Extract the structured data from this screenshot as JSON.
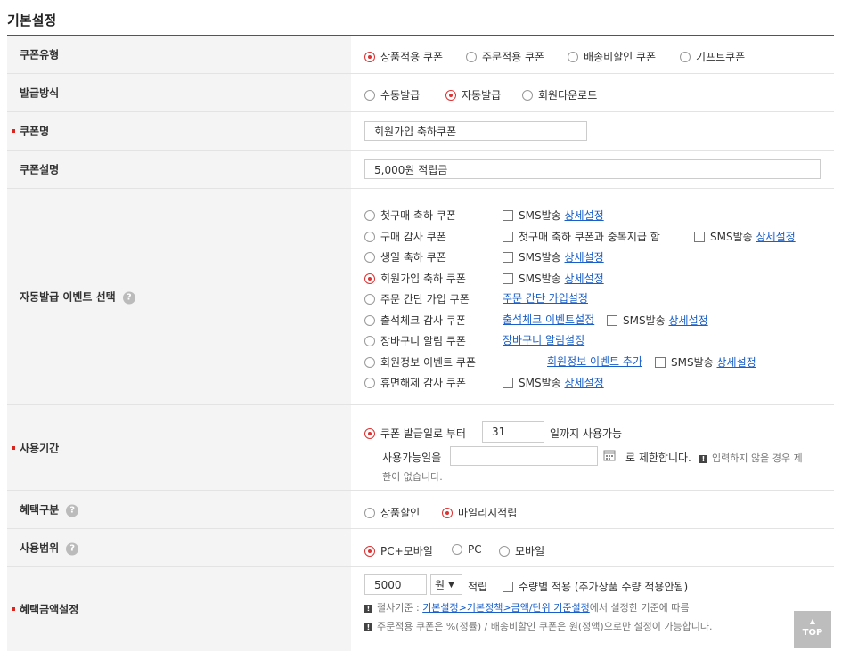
{
  "page": {
    "title": "기본설정"
  },
  "coupon_type": {
    "label": "쿠폰유형",
    "options": [
      "상품적용 쿠폰",
      "주문적용 쿠폰",
      "배송비할인 쿠폰",
      "기프트쿠폰"
    ],
    "selected": "상품적용 쿠폰"
  },
  "issue_method": {
    "label": "발급방식",
    "options": [
      "수동발급",
      "자동발급",
      "회원다운로드"
    ],
    "selected": "자동발급"
  },
  "coupon_name": {
    "label": "쿠폰명",
    "value": "회원가입 축하쿠폰"
  },
  "coupon_desc": {
    "label": "쿠폰설명",
    "value": "5,000원 적립금"
  },
  "auto_event": {
    "label": "자동발급 이벤트 선택",
    "sms": "SMS발송",
    "detail": "상세설정",
    "first_dup": "첫구매 축하 쿠폰과 중복지급 함",
    "options": [
      "첫구매 축하 쿠폰",
      "구매 감사 쿠폰",
      "생일 축하 쿠폰",
      "회원가입 축하 쿠폰",
      "주문 간단 가입 쿠폰",
      "출석체크 감사 쿠폰",
      "장바구니 알림 쿠폰",
      "회원정보 이벤트 쿠폰",
      "휴면해제 감사 쿠폰"
    ],
    "selected": "회원가입 축하 쿠폰",
    "links": {
      "simple_join": "주문 간단 가입설정",
      "attendance": "출석체크 이벤트설정",
      "cart_alarm": "장바구니 알림설정",
      "member_info": "회원정보 이벤트 추가"
    }
  },
  "usage_period": {
    "label": "사용기간",
    "option_text": "쿠폰 발급일로 부터",
    "days": "31",
    "days_suffix": "일까지 사용가능",
    "usable_date_label": "사용가능일을",
    "limit_text": "로 제한합니다.",
    "note_line1": "입력하지 않을 경우 제",
    "note_line2": "한이 없습니다."
  },
  "benefit_type": {
    "label": "혜택구분",
    "options": [
      "상품할인",
      "마일리지적립"
    ],
    "selected": "마일리지적립"
  },
  "usage_scope": {
    "label": "사용범위",
    "options": [
      "PC+모바일",
      "PC",
      "모바일"
    ],
    "selected": "PC+모바일"
  },
  "benefit_amount": {
    "label": "혜택금액설정",
    "amount": "5000",
    "unit": "원",
    "suffix": "적립",
    "qty_check": "수량별 적용 (추가상품 수량 적용안됨)",
    "note1_prefix": "절사기준 : ",
    "note1_link": "기본설정>기본정책>금액/단위 기준설정",
    "note1_suffix": "에서 설정한 기준에 따름",
    "note2": "주문적용 쿠폰은 %(정률) / 배송비할인 쿠폰은 원(정액)으로만 설정이 가능합니다."
  },
  "top_button": {
    "label": "TOP"
  },
  "colors": {
    "accent": "#d33333",
    "link": "#1a5fc9",
    "label_bg": "#f4f4f4"
  }
}
